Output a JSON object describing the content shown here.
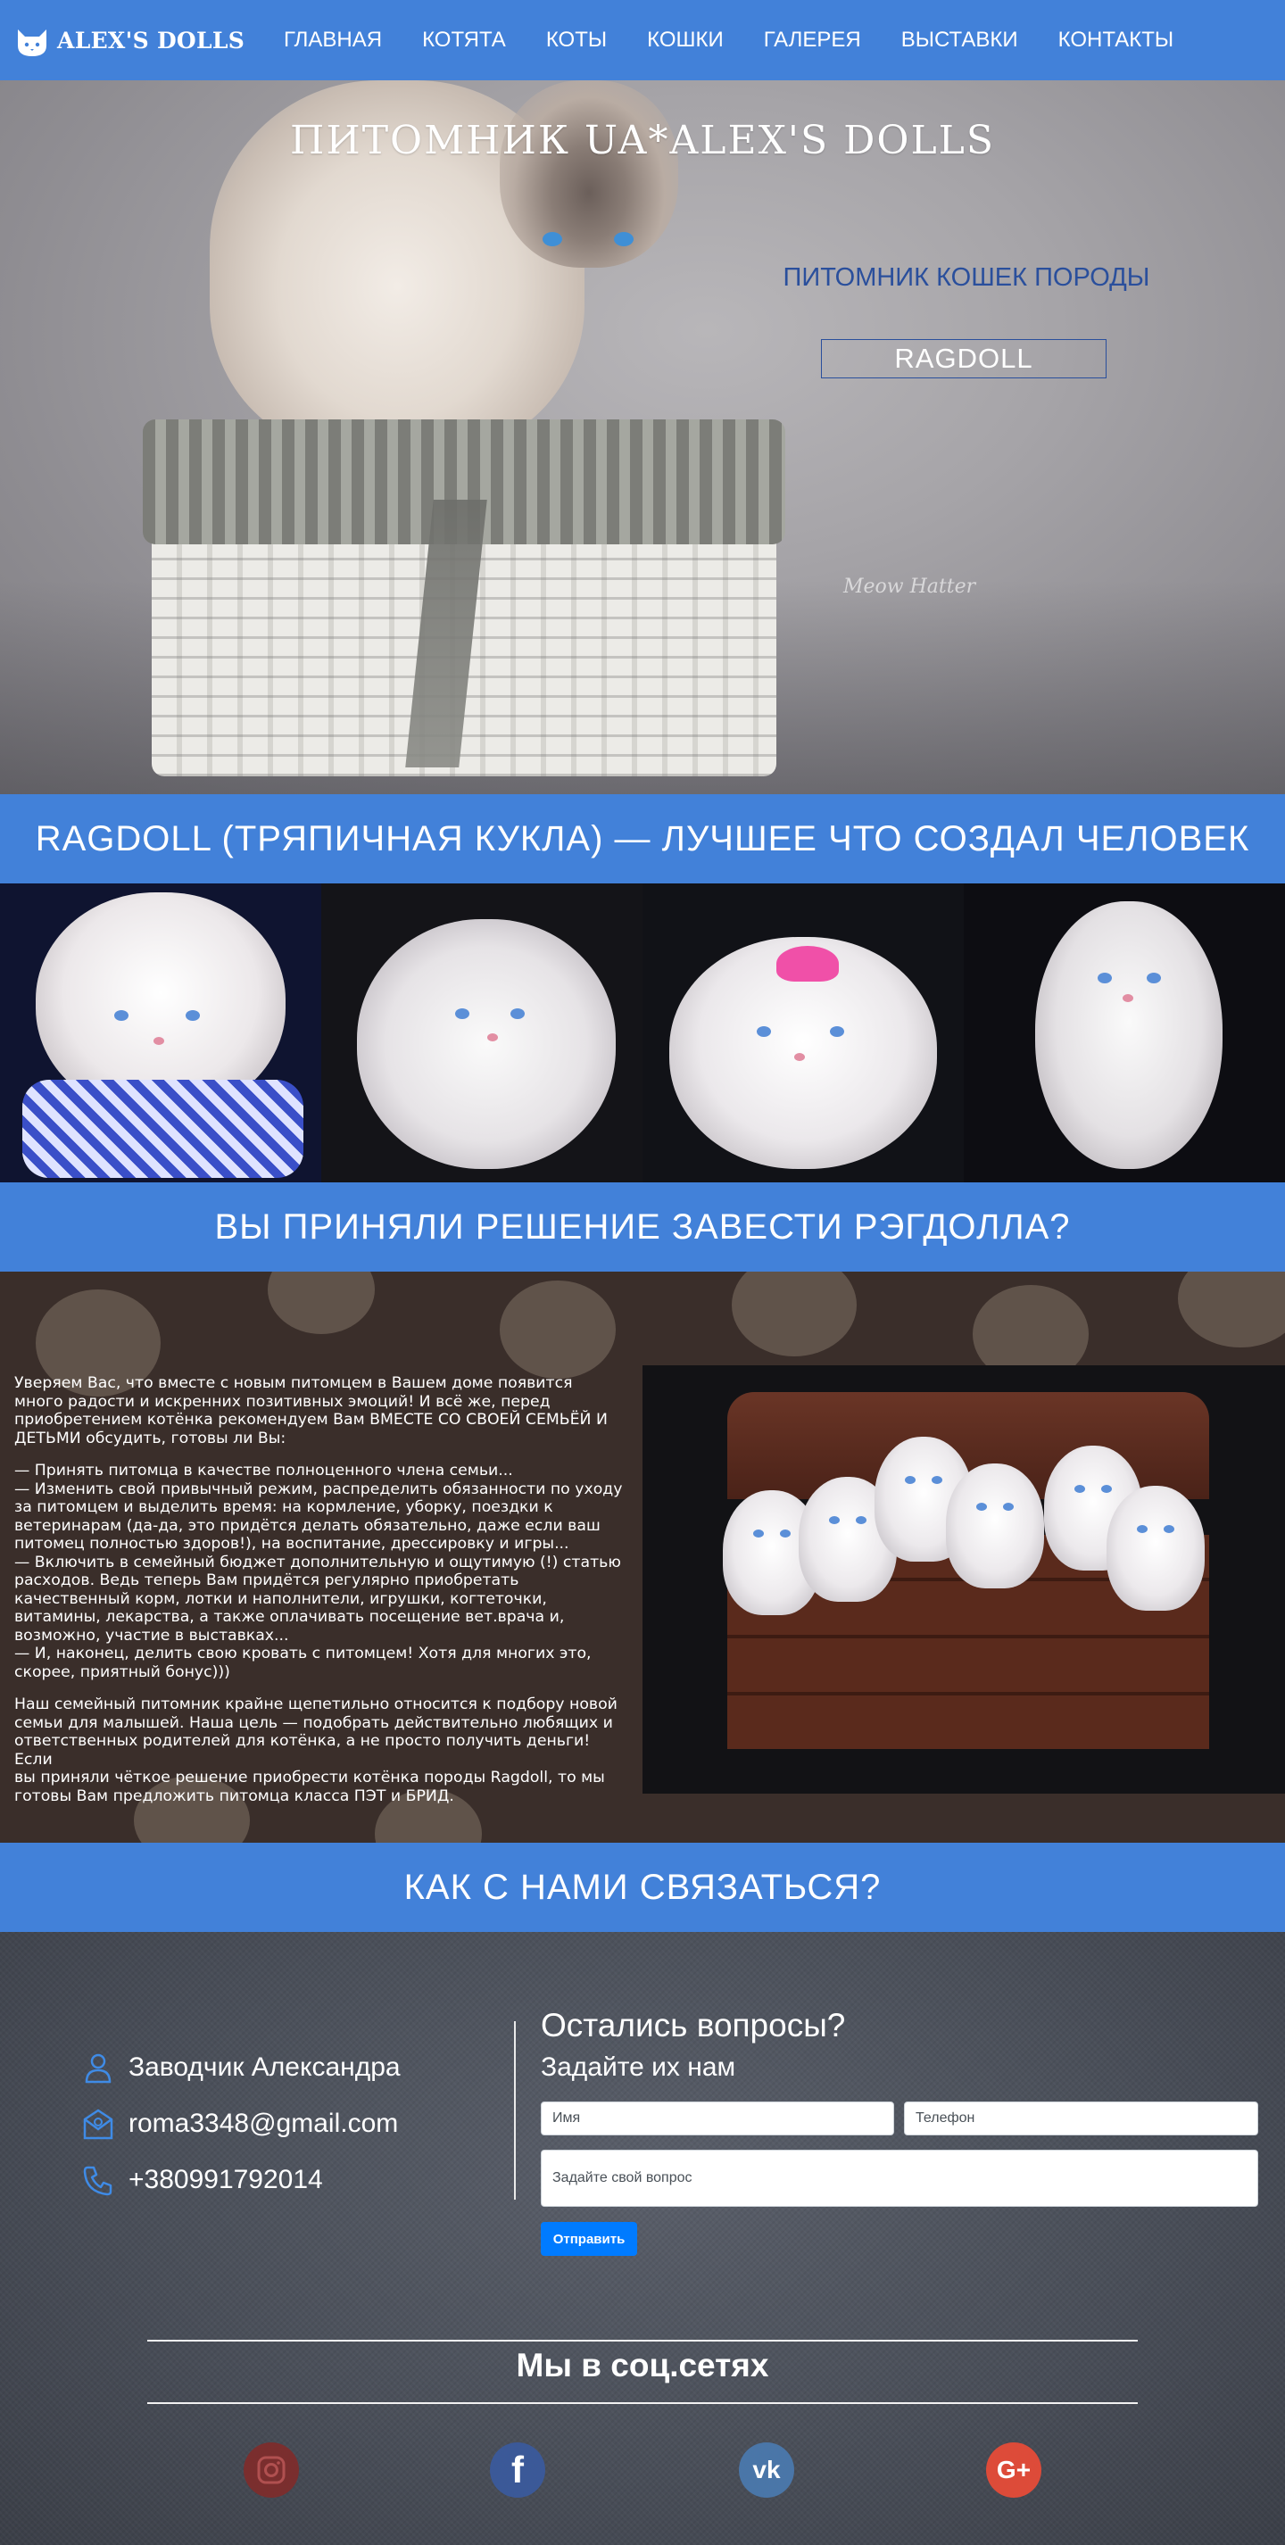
{
  "header": {
    "logo_text": "ALEX'S DOLLS",
    "nav": [
      "ГЛАВНАЯ",
      "КОТЯТА",
      "КОТЫ",
      "КОШКИ",
      "ГАЛЕРЕЯ",
      "ВЫСТАВКИ",
      "КОНТАКТЫ"
    ]
  },
  "hero": {
    "title": "ПИТОМНИК UA*ALEX'S DOLLS",
    "subtitle": "ПИТОМНИК КОШЕК ПОРОДЫ",
    "breed": "RAGDOLL",
    "signature": "Meow Hatter"
  },
  "banners": {
    "breed_heading": "RAGDOLL (ТРЯПИЧНАЯ КУКЛА) — ЛУЧШЕЕ ЧТО СОЗДАЛ ЧЕЛОВЕК",
    "decision_heading": "ВЫ ПРИНЯЛИ РЕШЕНИЕ ЗАВЕСТИ РЭГДОЛЛА?",
    "contact_heading": "КАК С НАМИ СВЯЗАТЬСЯ?"
  },
  "decision": {
    "paragraphs": [
      "Уверяем Вас, что вместе с новым питомцем в Вашем доме появится\nмного радости и искренних позитивных эмоций! И всё же, перед\nприобретением котёнка рекомендуем Вам ВМЕСТЕ СО СВОЕЙ СЕМЬЁЙ И\nДЕТЬМИ обсудить, готовы ли Вы:",
      "— Принять питомца в качестве полноценного члена семьи...\n— Изменить свой привычный режим, распределить обязанности по уходу\nза питомцем и выделить время: на кормление, уборку, поездки к\nветеринарам (да-да, это придётся делать обязательно, даже если ваш\nпитомец полностью здоров!), на воспитание, дрессировку и игры...\n— Включить в семейный бюджет дополнительную и ощутимую (!) статью\nрасходов. Ведь теперь Вам придётся регулярно приобретать\nкачественный корм, лотки и наполнители, игрушки, когтеточки,\nвитамины, лекарства, а также оплачивать посещение вет.врача и,\nвозможно, участие в выставках...\n— И, наконец, делить свою кровать с питомцем! Хотя для многих это,\nскорее, приятный бонус)))",
      "Наш семейный питомник крайне щепетильно относится к подбору новой\nсемьи для малышей. Наша цель — подобрать действительно любящих и\nответственных родителей для котёнка, а не просто получить деньги! Если\nвы приняли чёткое решение приобрести котёнка породы Ragdoll, то мы\nготовы Вам предложить питомца класса ПЭТ и БРИД."
    ]
  },
  "contact": {
    "breeder": "Заводчик Александра",
    "email": "roma3348@gmail.com",
    "phone": "+380991792014",
    "form_title": "Остались вопросы?",
    "form_subtitle": "Задайте их нам",
    "name_placeholder": "Имя",
    "phone_placeholder": "Телефон",
    "question_placeholder": "Задайте свой вопрос",
    "submit_label": "Отправить"
  },
  "social": {
    "title": "Мы в соц.сетях",
    "icons": [
      {
        "name": "instagram-icon",
        "color": "#7a2e2e"
      },
      {
        "name": "facebook-icon",
        "color": "#3b5998",
        "glyph": "f"
      },
      {
        "name": "vk-icon",
        "color": "#4a76a8",
        "glyph": "vk"
      },
      {
        "name": "google-plus-icon",
        "color": "#dd4b39",
        "glyph": "G+"
      }
    ]
  },
  "colors": {
    "accent": "#4281d9",
    "button": "#007bff",
    "subtitle": "#2a4f9c"
  }
}
